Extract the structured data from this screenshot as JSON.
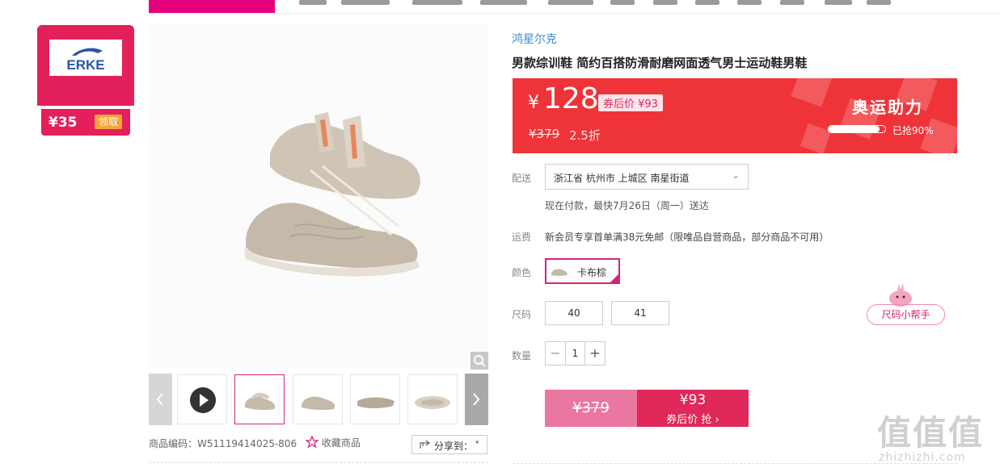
{
  "coupon": {
    "brand": "ERKE",
    "amount": "¥35",
    "claim_label": "领取"
  },
  "product": {
    "brand": "鸿星尔克",
    "title": "男款综训鞋 简约百搭防滑耐磨网面透气男士运动鞋男鞋",
    "code_label": "商品编码：W51119414025-806",
    "favorite_label": "收藏商品",
    "share_label": "分享到："
  },
  "price": {
    "yen": "¥",
    "current": "128",
    "after_coupon_tag": "券后价 ¥93",
    "original": "¥379",
    "discount": "2.5折",
    "event_title": "奥运助力",
    "sold_percent": 90,
    "sold_text": "已抢90%"
  },
  "delivery": {
    "label": "配送",
    "address": "浙江省 杭州市 上城区 南星街道",
    "estimate": "现在付款，最快7月26日（周一）送达"
  },
  "shipping": {
    "label": "运费",
    "text": "新会员专享首单满38元免邮（限唯品自营商品，部分商品不可用）"
  },
  "color": {
    "label": "颜色",
    "options": [
      "卡布棕"
    ]
  },
  "size": {
    "label": "尺码",
    "options": [
      "40",
      "41"
    ],
    "helper": "尺码小帮手"
  },
  "quantity": {
    "label": "数量",
    "value": "1",
    "minus": "−",
    "plus": "+"
  },
  "buy": {
    "original": "¥379",
    "price": "¥93",
    "label": "券后价 抢 ›"
  },
  "watermark": {
    "big": "值值值",
    "small": "zhizhizhi.com"
  },
  "colors": {
    "accent": "#e3205b",
    "brand_pink": "#d4237a",
    "price_red": "#ee3438"
  }
}
